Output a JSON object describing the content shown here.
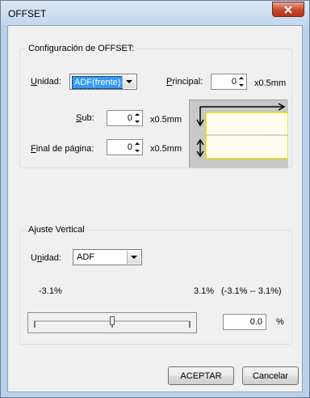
{
  "window": {
    "title": "OFFSET",
    "close_icon": "close-icon"
  },
  "offset_group": {
    "title": "Configuración de OFFSET:",
    "unit": {
      "label_mnemonic": "U",
      "label_rest": "nidad:",
      "value": "ADF(frente)"
    },
    "principal": {
      "label_mnemonic": "P",
      "label_rest": "rincipal:",
      "value": "0",
      "unit": "x0.5mm"
    },
    "sub": {
      "label_mnemonic": "S",
      "label_rest": "ub:",
      "value": "0",
      "unit": "x0.5mm"
    },
    "end_page": {
      "label_mnemonic": "F",
      "label_rest": "inal de página:",
      "value": "0",
      "unit": "x0.5mm"
    }
  },
  "vertical_group": {
    "title": "Ajuste Vertical",
    "unit": {
      "label_pre": "U",
      "label_mnemonic": "n",
      "label_rest": "idad:",
      "value": "ADF"
    },
    "min_label": "-3.1%",
    "max_label": "3.1%",
    "range_label": "(-3.1% -- 3.1%)",
    "value": "0.0",
    "value_unit": "%",
    "slider_position": 0.5
  },
  "buttons": {
    "ok": "ACEPTAR",
    "cancel": "Cancelar"
  },
  "colors": {
    "accent": "#3399ff",
    "paper": "#fffdf0",
    "paper_edge": "#e8d800"
  }
}
